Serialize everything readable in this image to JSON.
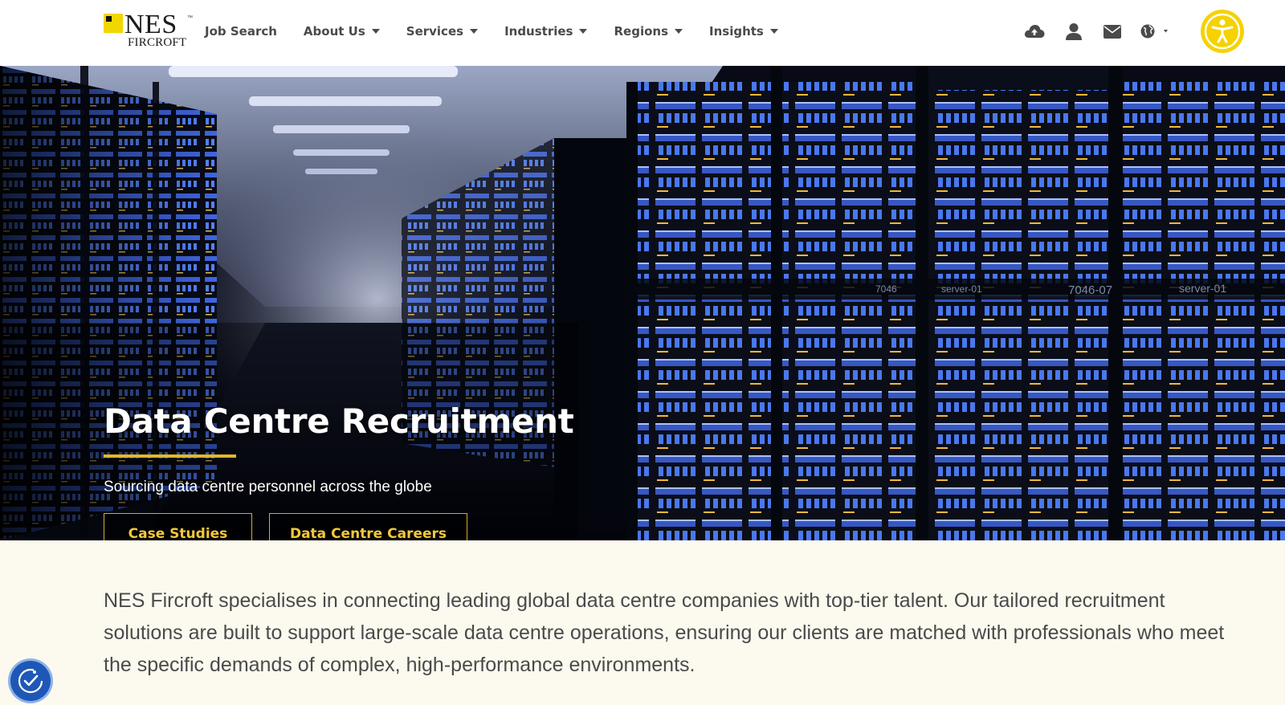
{
  "brand": {
    "name": "NES",
    "sub": "FIRCROFT",
    "mark": "™",
    "color": "#f2d600"
  },
  "nav": [
    {
      "label": "Job Search",
      "dropdown": false
    },
    {
      "label": "About Us",
      "dropdown": true
    },
    {
      "label": "Services",
      "dropdown": true
    },
    {
      "label": "Industries",
      "dropdown": true
    },
    {
      "label": "Regions",
      "dropdown": true
    },
    {
      "label": "Insights",
      "dropdown": true
    }
  ],
  "header_icons": [
    "cloud-upload-icon",
    "user-icon",
    "envelope-icon",
    "globe-icon"
  ],
  "hero": {
    "title": "Data Centre Recruitment",
    "subtitle": "Sourcing data centre personnel across the globe",
    "buttons": [
      "Case Studies",
      "Data Centre Careers"
    ],
    "rack_labels": [
      "server-01",
      "7046",
      "7046-07",
      "server-01"
    ],
    "accent": "#e0b92a"
  },
  "intro": {
    "text": "NES Fircroft specialises in connecting leading global data centre companies with top-tier talent. Our tailored recruitment solutions are built to support large-scale data centre operations, ensuring our clients are matched with professionals who meet the specific demands of complex, high-performance environments."
  },
  "colors": {
    "accessibility_badge": "#f5d200",
    "accessibility_fab": "#1e57b6",
    "page_bg": "#fcfaef"
  }
}
